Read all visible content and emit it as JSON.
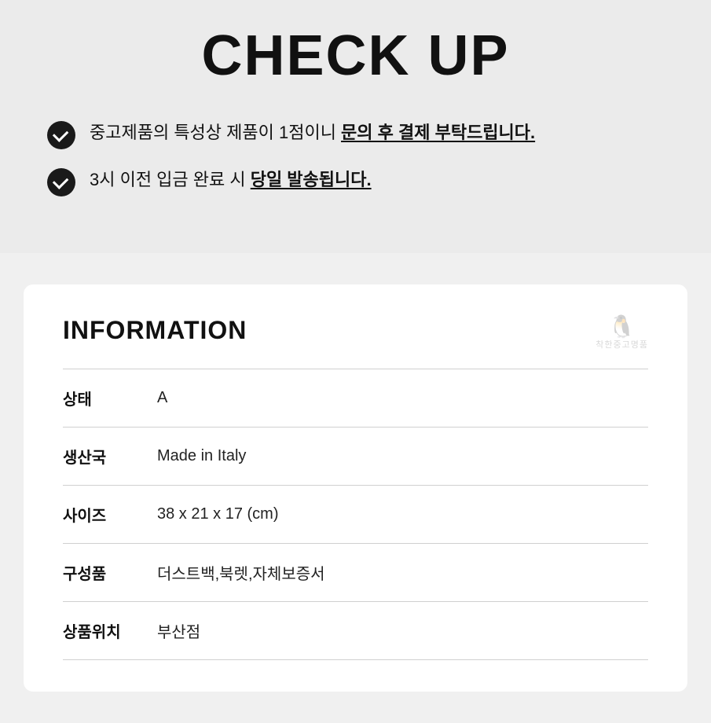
{
  "header": {
    "title": "CHECK UP"
  },
  "checkItems": [
    {
      "id": "item1",
      "text_before": "중고제품의 특성상 제품이 1점이니 ",
      "text_bold": "문의 후 결제 부탁드립니다.",
      "text_after": ""
    },
    {
      "id": "item2",
      "text_before": "3시 이전 입금 완료 시 ",
      "text_bold": "당일 발송됩니다.",
      "text_after": ""
    }
  ],
  "infoCard": {
    "title": "INFORMATION",
    "watermark": {
      "icon": "🐧",
      "text": "착한중고명품"
    },
    "rows": [
      {
        "label": "상태",
        "value": "A"
      },
      {
        "label": "생산국",
        "value": "Made in Italy"
      },
      {
        "label": "사이즈",
        "value": "38 x 21 x 17 (cm)"
      },
      {
        "label": "구성품",
        "value": "더스트백,북렛,자체보증서"
      },
      {
        "label": "상품위치",
        "value": "부산점"
      }
    ]
  }
}
